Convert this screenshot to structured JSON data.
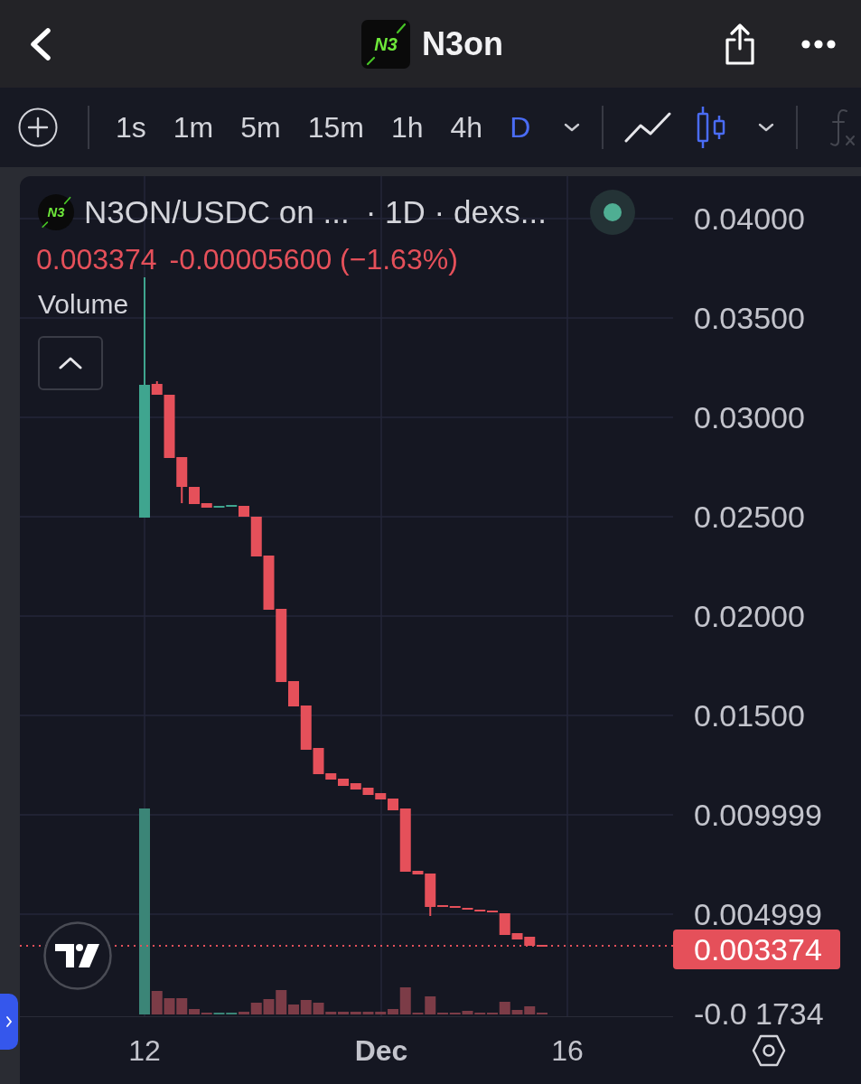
{
  "nav_bar": {
    "logo_text": "N3",
    "title": "N3on"
  },
  "toolbar": {
    "intervals": [
      {
        "label": "1s",
        "selected": false
      },
      {
        "label": "1m",
        "selected": false
      },
      {
        "label": "5m",
        "selected": false
      },
      {
        "label": "15m",
        "selected": false
      },
      {
        "label": "1h",
        "selected": false
      },
      {
        "label": "4h",
        "selected": false
      },
      {
        "label": "D",
        "selected": true
      }
    ],
    "chart_types": [
      {
        "kind": "line",
        "selected": false
      },
      {
        "kind": "candles",
        "selected": true
      }
    ],
    "indicators": {
      "disabled": true
    }
  },
  "legend": {
    "logo_text": "N3",
    "symbol": "N3ON/USDC on ...",
    "details": "· 1D · dexs...",
    "live": true,
    "last_price": "0.003374",
    "change": "-0.00005600 (−1.63%)",
    "falling": true,
    "volume_label": "Volume"
  },
  "price_axis": {
    "labels": [
      "0.04000",
      "0.03500",
      "0.03000",
      "0.02500",
      "0.02000",
      "0.01500",
      "0.009999",
      "0.004999",
      "-0.0 1734"
    ],
    "current_price": "0.003374"
  },
  "time_axis": {
    "labels": [
      {
        "text": "12",
        "kind": "day"
      },
      {
        "text": "Dec",
        "kind": "month"
      },
      {
        "text": "16",
        "kind": "day"
      }
    ]
  }
}
